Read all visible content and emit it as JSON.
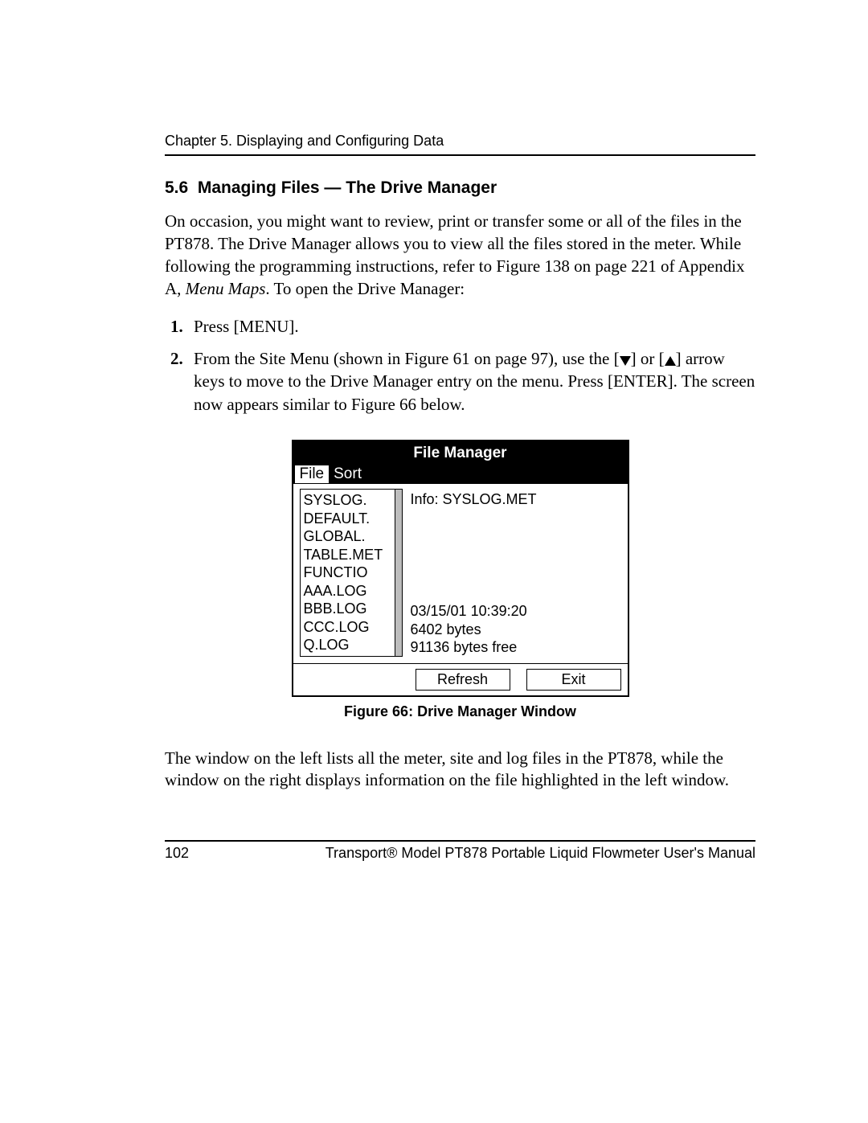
{
  "header": {
    "chapter_line": "Chapter 5. Displaying and Configuring Data"
  },
  "section": {
    "number": "5.6",
    "title": "Managing Files — The Drive Manager"
  },
  "intro_paragraph_parts": {
    "a": "On occasion, you might want to review, print or transfer some or all of the files in the PT878. The Drive Manager allows you to view all the files stored in the meter. While following the programming instructions, refer to Figure 138 on page 221 of Appendix A, ",
    "b": "Menu Maps",
    "c": ". To open the Drive Manager:"
  },
  "steps": {
    "s1": "Press [MENU].",
    "s2a": "From the Site Menu (shown in Figure 61 on page 97), use the [",
    "s2b": "] or [",
    "s2c": "] arrow keys to move to the Drive Manager entry on the menu. Press [ENTER]. The screen now appears similar to Figure 66 below."
  },
  "file_manager": {
    "title": "File Manager",
    "menu": {
      "file": "File",
      "sort": "Sort"
    },
    "files": {
      "f1": "SYSLOG.",
      "f2": "DEFAULT.",
      "f3": "GLOBAL.",
      "f4": "TABLE.MET",
      "f5": "FUNCTIO",
      "f6": "AAA.LOG",
      "f7": "BBB.LOG",
      "f8": "CCC.LOG",
      "f9": "Q.LOG"
    },
    "info_label": "Info: SYSLOG.MET",
    "datetime": "03/15/01   10:39:20",
    "size": "6402 bytes",
    "free": "91136 bytes free",
    "buttons": {
      "refresh": "Refresh",
      "exit": "Exit"
    }
  },
  "figure_caption": "Figure 66: Drive Manager Window",
  "closing_paragraph": "The window on the left lists all the meter, site and log files in the PT878, while the window on the right displays information on the file highlighted in the left window.",
  "footer": {
    "page_number": "102",
    "manual_title": "Transport® Model PT878 Portable Liquid Flowmeter User's Manual"
  }
}
